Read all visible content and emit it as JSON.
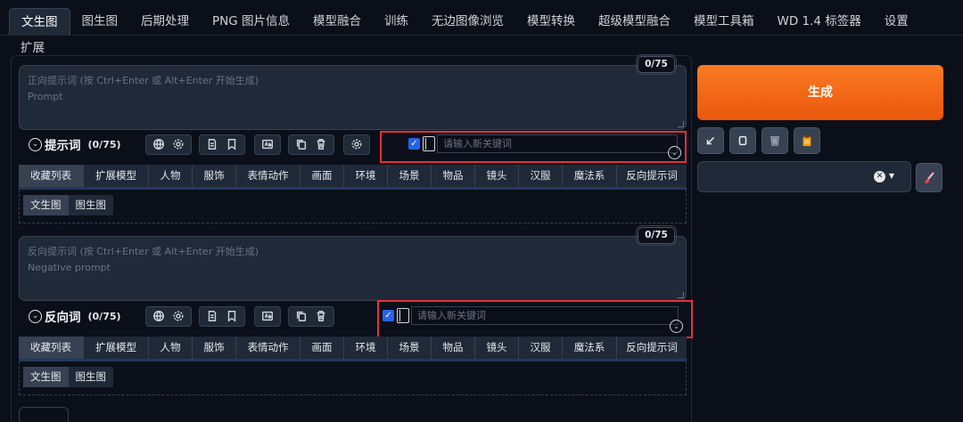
{
  "tabs": [
    "文生图",
    "图生图",
    "后期处理",
    "PNG 图片信息",
    "模型融合",
    "训练",
    "无边图像浏览",
    "模型转换",
    "超级模型融合",
    "模型工具箱",
    "WD 1.4 标签器",
    "设置"
  ],
  "tab_row2": "扩展",
  "positive": {
    "placeholder": "正向提示词 (按 Ctrl+Enter 或 Alt+Enter 开始生成)\nPrompt",
    "token_count": "0/75",
    "title": "提示词",
    "count": "(0/75)",
    "kw_placeholder": "请输入新关键词"
  },
  "negative": {
    "placeholder": "反向提示词 (按 Ctrl+Enter 或 Alt+Enter 开始生成)\nNegative prompt",
    "token_count": "0/75",
    "title": "反向词",
    "count": "(0/75)",
    "kw_placeholder": "请输入新关键词"
  },
  "categories": [
    "收藏列表",
    "扩展模型",
    "人物",
    "服饰",
    "表情动作",
    "画面",
    "环境",
    "场景",
    "物品",
    "镜头",
    "汉服",
    "魔法系",
    "反向提示词"
  ],
  "sub_tabs": [
    "文生图",
    "图生图"
  ],
  "generate_label": "生成",
  "colors": {
    "accent": "#ea580c",
    "highlight": "#e5313a",
    "checkbox": "#2563eb"
  }
}
